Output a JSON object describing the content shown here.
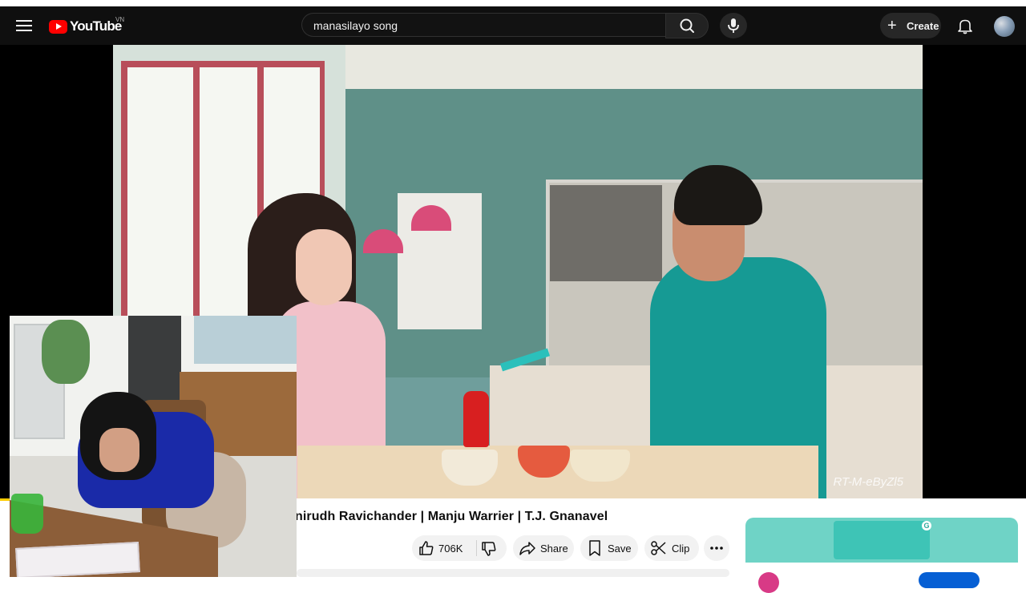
{
  "masthead": {
    "menu_icon": "hamburger-menu-icon",
    "logo_text": "YouTube",
    "country_code": "VN",
    "search_value": "manasilayo song",
    "search_icon": "search-icon",
    "mic_icon": "microphone-icon",
    "create_label": "Create",
    "bell_icon": "bell-icon",
    "brand_color": "#ff0000",
    "bg_color": "#0f0f0f"
  },
  "video": {
    "watermark": "RT-M-eByZl5"
  },
  "watch": {
    "title": "nirudh Ravichander | Manju Warrier | T.J. Gnanavel",
    "like_count": "706K",
    "like_icon": "thumbs-up-icon",
    "dislike_icon": "thumbs-down-icon",
    "share_label": "Share",
    "share_icon": "share-arrow-icon",
    "save_label": "Save",
    "save_icon": "bookmark-icon",
    "clip_label": "Clip",
    "clip_icon": "scissors-icon",
    "more_icon": "more-horizontal-icon"
  },
  "ad": {
    "accent": "#6fd3c6"
  }
}
